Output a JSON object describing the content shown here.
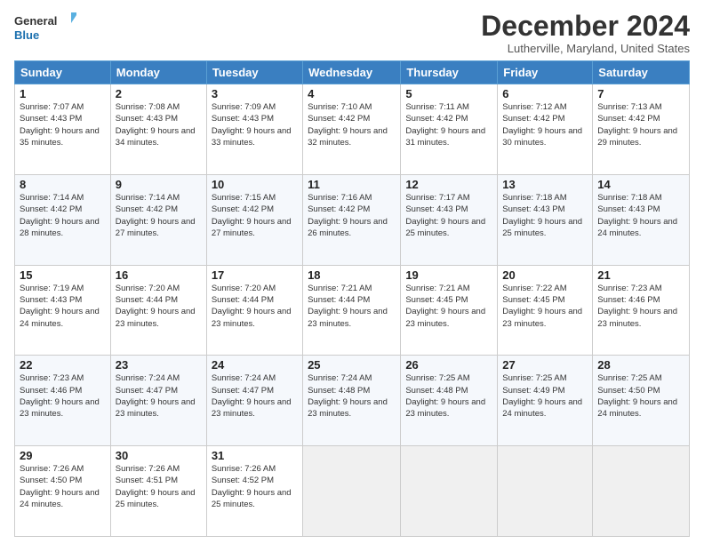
{
  "header": {
    "logo_line1": "General",
    "logo_line2": "Blue",
    "month_title": "December 2024",
    "location": "Lutherville, Maryland, United States"
  },
  "weekdays": [
    "Sunday",
    "Monday",
    "Tuesday",
    "Wednesday",
    "Thursday",
    "Friday",
    "Saturday"
  ],
  "weeks": [
    [
      {
        "day": "1",
        "sunrise": "7:07 AM",
        "sunset": "4:43 PM",
        "daylight": "9 hours and 35 minutes."
      },
      {
        "day": "2",
        "sunrise": "7:08 AM",
        "sunset": "4:43 PM",
        "daylight": "9 hours and 34 minutes."
      },
      {
        "day": "3",
        "sunrise": "7:09 AM",
        "sunset": "4:43 PM",
        "daylight": "9 hours and 33 minutes."
      },
      {
        "day": "4",
        "sunrise": "7:10 AM",
        "sunset": "4:42 PM",
        "daylight": "9 hours and 32 minutes."
      },
      {
        "day": "5",
        "sunrise": "7:11 AM",
        "sunset": "4:42 PM",
        "daylight": "9 hours and 31 minutes."
      },
      {
        "day": "6",
        "sunrise": "7:12 AM",
        "sunset": "4:42 PM",
        "daylight": "9 hours and 30 minutes."
      },
      {
        "day": "7",
        "sunrise": "7:13 AM",
        "sunset": "4:42 PM",
        "daylight": "9 hours and 29 minutes."
      }
    ],
    [
      {
        "day": "8",
        "sunrise": "7:14 AM",
        "sunset": "4:42 PM",
        "daylight": "9 hours and 28 minutes."
      },
      {
        "day": "9",
        "sunrise": "7:14 AM",
        "sunset": "4:42 PM",
        "daylight": "9 hours and 27 minutes."
      },
      {
        "day": "10",
        "sunrise": "7:15 AM",
        "sunset": "4:42 PM",
        "daylight": "9 hours and 27 minutes."
      },
      {
        "day": "11",
        "sunrise": "7:16 AM",
        "sunset": "4:42 PM",
        "daylight": "9 hours and 26 minutes."
      },
      {
        "day": "12",
        "sunrise": "7:17 AM",
        "sunset": "4:43 PM",
        "daylight": "9 hours and 25 minutes."
      },
      {
        "day": "13",
        "sunrise": "7:18 AM",
        "sunset": "4:43 PM",
        "daylight": "9 hours and 25 minutes."
      },
      {
        "day": "14",
        "sunrise": "7:18 AM",
        "sunset": "4:43 PM",
        "daylight": "9 hours and 24 minutes."
      }
    ],
    [
      {
        "day": "15",
        "sunrise": "7:19 AM",
        "sunset": "4:43 PM",
        "daylight": "9 hours and 24 minutes."
      },
      {
        "day": "16",
        "sunrise": "7:20 AM",
        "sunset": "4:44 PM",
        "daylight": "9 hours and 23 minutes."
      },
      {
        "day": "17",
        "sunrise": "7:20 AM",
        "sunset": "4:44 PM",
        "daylight": "9 hours and 23 minutes."
      },
      {
        "day": "18",
        "sunrise": "7:21 AM",
        "sunset": "4:44 PM",
        "daylight": "9 hours and 23 minutes."
      },
      {
        "day": "19",
        "sunrise": "7:21 AM",
        "sunset": "4:45 PM",
        "daylight": "9 hours and 23 minutes."
      },
      {
        "day": "20",
        "sunrise": "7:22 AM",
        "sunset": "4:45 PM",
        "daylight": "9 hours and 23 minutes."
      },
      {
        "day": "21",
        "sunrise": "7:23 AM",
        "sunset": "4:46 PM",
        "daylight": "9 hours and 23 minutes."
      }
    ],
    [
      {
        "day": "22",
        "sunrise": "7:23 AM",
        "sunset": "4:46 PM",
        "daylight": "9 hours and 23 minutes."
      },
      {
        "day": "23",
        "sunrise": "7:24 AM",
        "sunset": "4:47 PM",
        "daylight": "9 hours and 23 minutes."
      },
      {
        "day": "24",
        "sunrise": "7:24 AM",
        "sunset": "4:47 PM",
        "daylight": "9 hours and 23 minutes."
      },
      {
        "day": "25",
        "sunrise": "7:24 AM",
        "sunset": "4:48 PM",
        "daylight": "9 hours and 23 minutes."
      },
      {
        "day": "26",
        "sunrise": "7:25 AM",
        "sunset": "4:48 PM",
        "daylight": "9 hours and 23 minutes."
      },
      {
        "day": "27",
        "sunrise": "7:25 AM",
        "sunset": "4:49 PM",
        "daylight": "9 hours and 24 minutes."
      },
      {
        "day": "28",
        "sunrise": "7:25 AM",
        "sunset": "4:50 PM",
        "daylight": "9 hours and 24 minutes."
      }
    ],
    [
      {
        "day": "29",
        "sunrise": "7:26 AM",
        "sunset": "4:50 PM",
        "daylight": "9 hours and 24 minutes."
      },
      {
        "day": "30",
        "sunrise": "7:26 AM",
        "sunset": "4:51 PM",
        "daylight": "9 hours and 25 minutes."
      },
      {
        "day": "31",
        "sunrise": "7:26 AM",
        "sunset": "4:52 PM",
        "daylight": "9 hours and 25 minutes."
      },
      null,
      null,
      null,
      null
    ]
  ]
}
